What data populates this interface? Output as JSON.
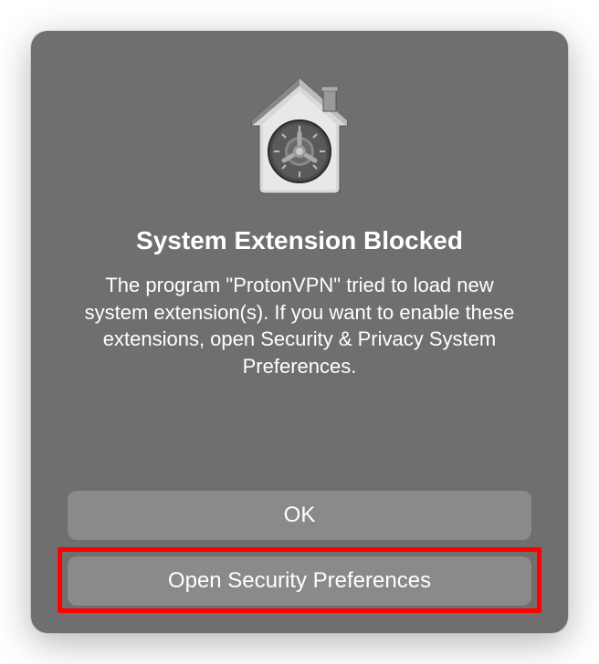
{
  "dialog": {
    "icon_name": "security-gatekeeper-icon",
    "title": "System Extension Blocked",
    "message": "The program \"ProtonVPN\" tried to load new system extension(s). If you want to enable these extensions, open Security & Privacy System Preferences.",
    "buttons": {
      "ok_label": "OK",
      "open_prefs_label": "Open Security Preferences"
    },
    "highlighted_button": "open_prefs"
  },
  "colors": {
    "dialog_bg": "#6f6f6f",
    "button_bg": "#8a8a8a",
    "text": "#ffffff",
    "highlight": "#ff0000"
  }
}
